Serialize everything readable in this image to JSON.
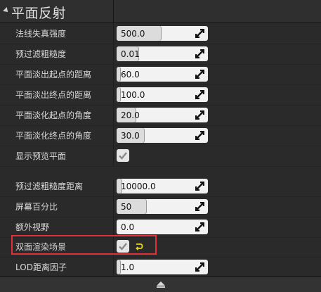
{
  "section": {
    "title": "平面反射",
    "arrow_icon": "collapse-arrow-icon"
  },
  "rows": [
    {
      "label": "法线失真强度",
      "type": "number",
      "value": "500.0",
      "fill": 0.5
    },
    {
      "label": "预过滤粗糙度",
      "type": "number",
      "value": "0.01",
      "fill": 0.23
    },
    {
      "label": "平面淡出起点的距离",
      "type": "number",
      "value": "60.0",
      "fill": 0.04
    },
    {
      "label": "平面淡出终点的距离",
      "type": "number",
      "value": "100.0",
      "fill": 0.04
    },
    {
      "label": "平面淡化起点的角度",
      "type": "number",
      "value": "20.0",
      "fill": 0.2
    },
    {
      "label": "平面淡化终点的角度",
      "type": "number",
      "value": "30.0",
      "fill": 0.3
    },
    {
      "label": "显示预览平面",
      "type": "checkbox",
      "checked": true
    },
    {
      "label": "预过滤粗糙度距离",
      "type": "number",
      "value": "10000.0",
      "fill": 0.04
    },
    {
      "label": "屏幕百分比",
      "type": "number",
      "value": "50",
      "fill": 0.33
    },
    {
      "label": "额外视野",
      "type": "number",
      "value": "0.0",
      "fill": 0.0
    },
    {
      "label": "双面渲染场景",
      "type": "checkbox",
      "checked": true,
      "reset": true
    },
    {
      "label": "LOD距离因子",
      "type": "number",
      "value": "1.0",
      "fill": 0.04
    }
  ],
  "footer": {
    "icon": "expand-up-arrow-icon"
  },
  "colors": {
    "highlight": "#e2303a",
    "reset_icon": "#e8d21f"
  }
}
